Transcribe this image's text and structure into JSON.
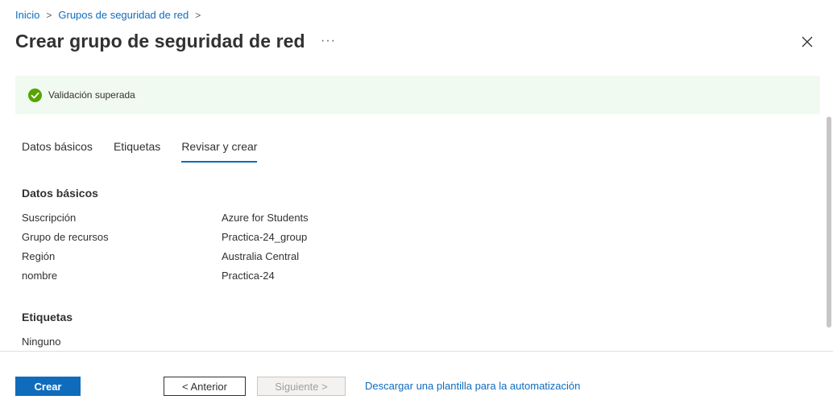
{
  "breadcrumb": {
    "home": "Inicio",
    "parent": "Grupos de seguridad de red"
  },
  "header": {
    "title": "Crear grupo de seguridad de red",
    "more": "···"
  },
  "validation": {
    "message": "Validación superada"
  },
  "tabs": [
    {
      "label": "Datos básicos"
    },
    {
      "label": "Etiquetas"
    },
    {
      "label": "Revisar y crear"
    }
  ],
  "basics": {
    "title": "Datos básicos",
    "rows": [
      {
        "key": "Suscripción",
        "value": "Azure for Students"
      },
      {
        "key": "Grupo de recursos",
        "value": "Practica-24_group"
      },
      {
        "key": "Región",
        "value": "Australia Central"
      },
      {
        "key": "nombre",
        "value": "Practica-24"
      }
    ]
  },
  "tags": {
    "title": "Etiquetas",
    "value": "Ninguno"
  },
  "footer": {
    "create": "Crear",
    "previous": "< Anterior",
    "next": "Siguiente >",
    "download": "Descargar una plantilla para la automatización"
  },
  "colors": {
    "accent": "#0f6cbd",
    "success": "#57a300",
    "success_bg": "#f1faf1"
  }
}
